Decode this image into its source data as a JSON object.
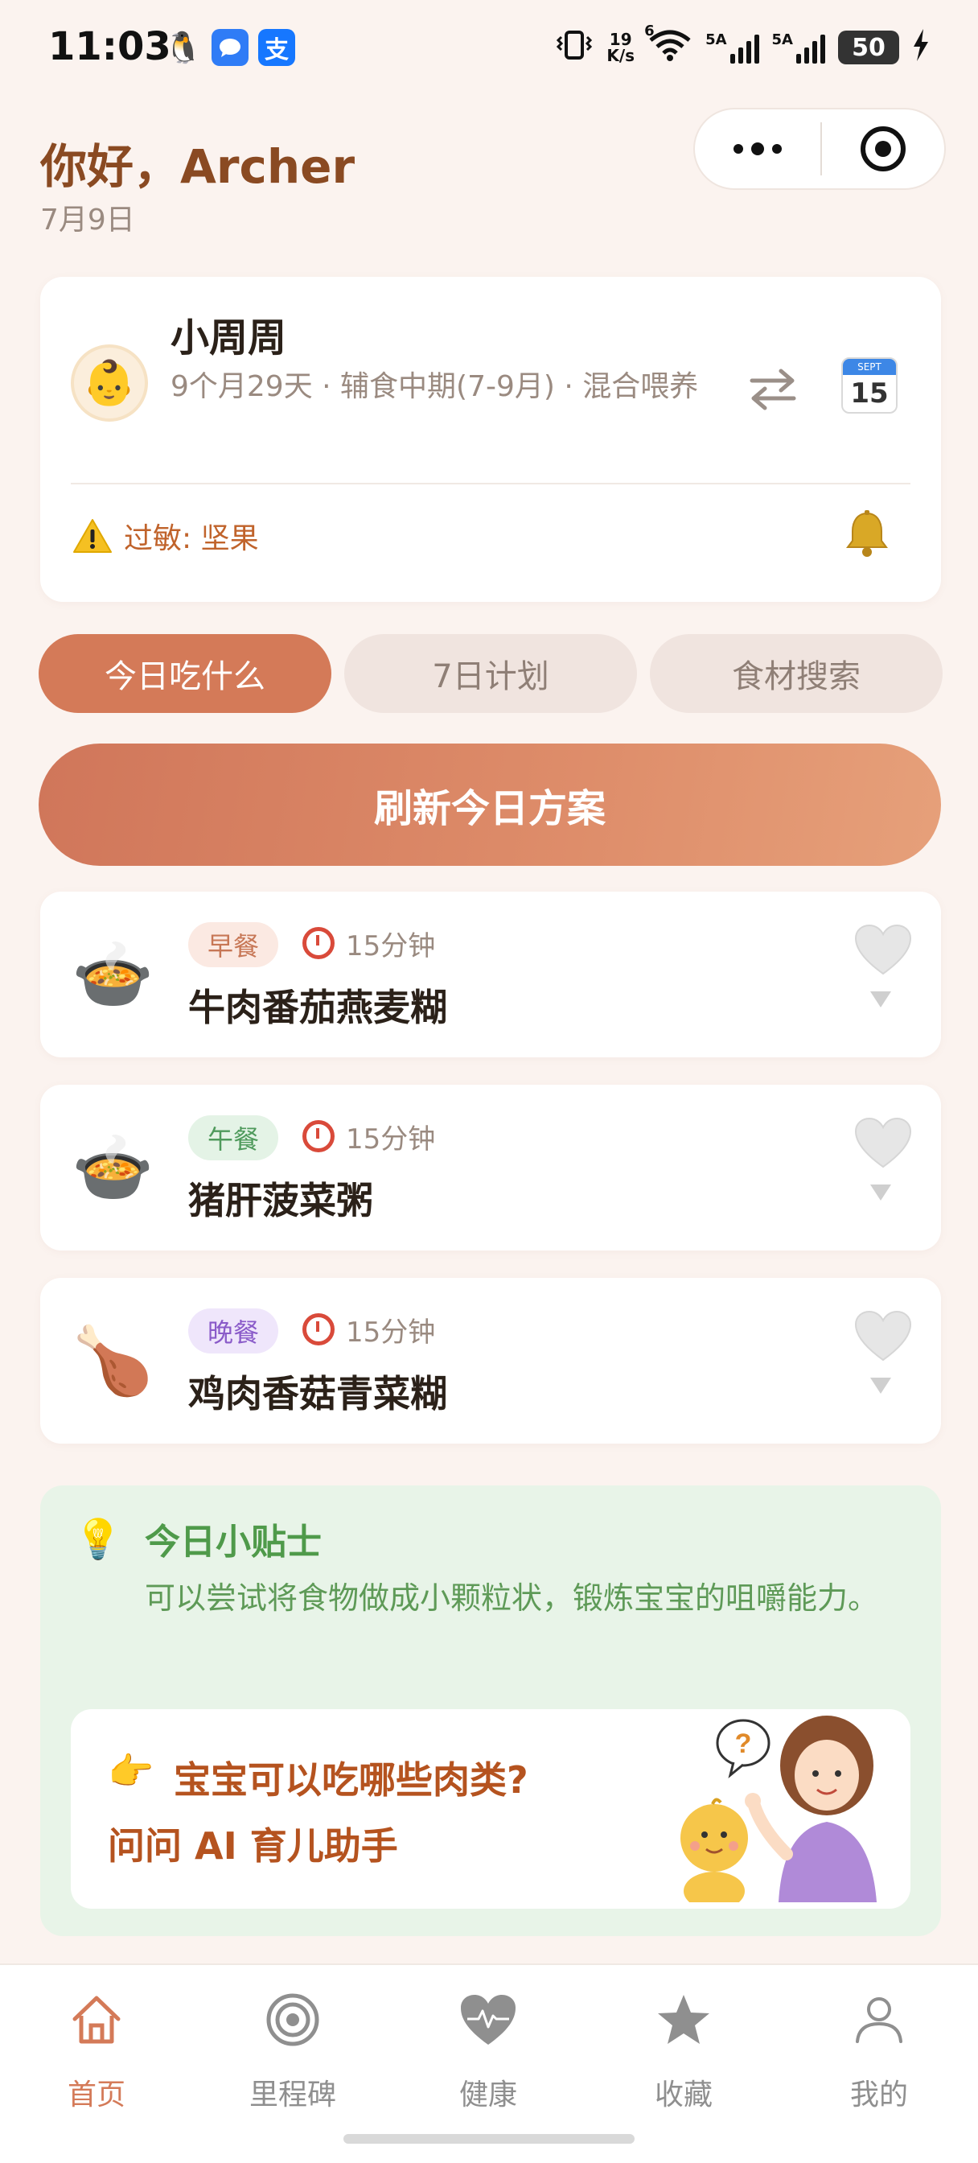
{
  "status_bar": {
    "time": "11:03",
    "net_speed_top": "19",
    "net_speed_bottom": "K/s",
    "wifi_label": "6",
    "sim1_label": "5A",
    "sim2_label": "5A",
    "battery": "50"
  },
  "header": {
    "greeting": "你好，Archer",
    "date": "7月9日"
  },
  "baby": {
    "name": "小周周",
    "info": "9个月29天 · 辅食中期(7-9月) · 混合喂养",
    "calendar_month": "SEPT",
    "calendar_day": "15",
    "allergy": "过敏: 坚果"
  },
  "tabs": [
    {
      "label": "今日吃什么",
      "active": true
    },
    {
      "label": "7日计划",
      "active": false
    },
    {
      "label": "食材搜索",
      "active": false
    }
  ],
  "refresh_label": "刷新今日方案",
  "meals": [
    {
      "tag": "早餐",
      "time": "15分钟",
      "name": "牛肉番茄燕麦糊",
      "icon": "soup-bowl-icon"
    },
    {
      "tag": "午餐",
      "time": "15分钟",
      "name": "猪肝菠菜粥",
      "icon": "soup-bowl-icon"
    },
    {
      "tag": "晚餐",
      "time": "15分钟",
      "name": "鸡肉香菇青菜糊",
      "icon": "drumstick-icon"
    }
  ],
  "tips": {
    "title": "今日小贴士",
    "text": "可以尝试将食物做成小颗粒状，锻炼宝宝的咀嚼能力。",
    "ai_question": "宝宝可以吃哪些肉类?",
    "ai_cta": "问问 AI 育儿助手",
    "bubble": "?"
  },
  "nav": [
    {
      "label": "首页",
      "icon": "home-icon",
      "active": true
    },
    {
      "label": "里程碑",
      "icon": "target-icon",
      "active": false
    },
    {
      "label": "健康",
      "icon": "heart-pulse-icon",
      "active": false
    },
    {
      "label": "收藏",
      "icon": "star-icon",
      "active": false
    },
    {
      "label": "我的",
      "icon": "user-icon",
      "active": false
    }
  ],
  "colors": {
    "accent": "#d47a58",
    "background": "#fbf3ef",
    "greeting": "#8a4a22",
    "tips_bg": "#e8f4e8",
    "tips_text": "#5e9a57"
  }
}
